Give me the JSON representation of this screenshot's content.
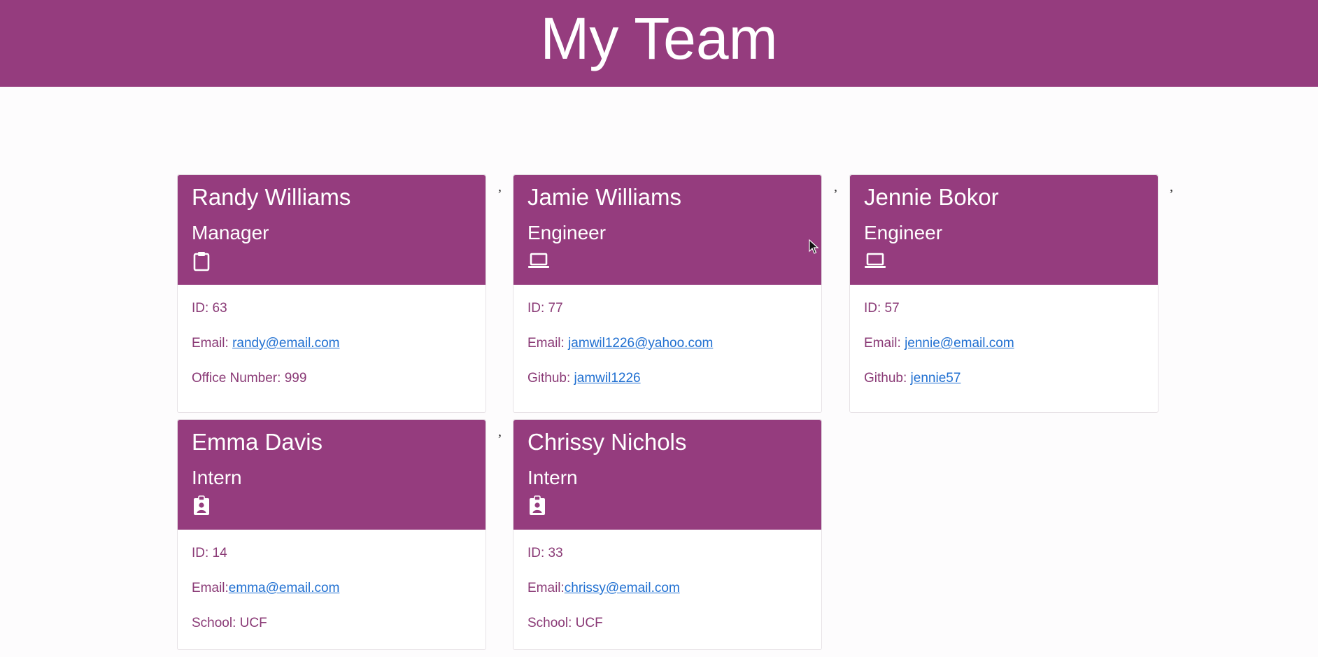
{
  "page": {
    "title": "My Team",
    "separator": ","
  },
  "team": [
    {
      "name": "Randy Williams",
      "role": "Manager",
      "icon": "clipboard-icon",
      "id_label": "ID: 63",
      "email_label": "Email: ",
      "email": "randy@email.com",
      "extra_label": "Office Number: 999",
      "extra_link": ""
    },
    {
      "name": "Jamie Williams",
      "role": "Engineer",
      "icon": "laptop-icon",
      "id_label": "ID: 77",
      "email_label": "Email: ",
      "email": "jamwil1226@yahoo.com",
      "extra_label": "Github: ",
      "extra_link": "jamwil1226"
    },
    {
      "name": "Jennie Bokor",
      "role": "Engineer",
      "icon": "laptop-icon",
      "id_label": "ID: 57",
      "email_label": "Email: ",
      "email": "jennie@email.com",
      "extra_label": "Github: ",
      "extra_link": "jennie57"
    },
    {
      "name": "Emma Davis",
      "role": "Intern",
      "icon": "id-badge-icon",
      "id_label": "ID: 14",
      "email_label": "Email:",
      "email": "emma@email.com",
      "extra_label": "School: UCF",
      "extra_link": ""
    },
    {
      "name": "Chrissy Nichols",
      "role": "Intern",
      "icon": "id-badge-icon",
      "id_label": "ID: 33",
      "email_label": "Email:",
      "email": "chrissy@email.com",
      "extra_label": "School: UCF",
      "extra_link": ""
    }
  ],
  "colors": {
    "primary": "#953c7e",
    "text": "#8a3a76",
    "link": "#1f6fd1"
  }
}
